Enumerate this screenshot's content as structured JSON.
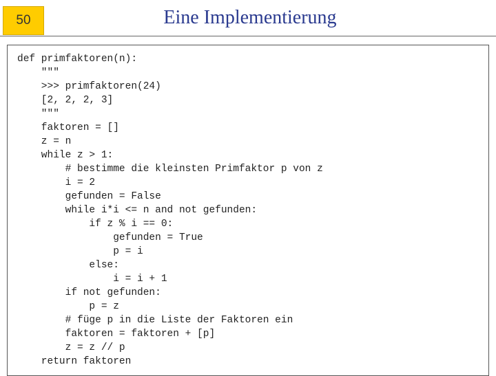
{
  "header": {
    "slide_number": "50",
    "title": "Eine Implementierung"
  },
  "code": {
    "lines": [
      "def primfaktoren(n):",
      "    \"\"\"",
      "    >>> primfaktoren(24)",
      "    [2, 2, 2, 3]",
      "    \"\"\"",
      "    faktoren = []",
      "    z = n",
      "    while z > 1:",
      "        # bestimme die kleinsten Primfaktor p von z",
      "        i = 2",
      "        gefunden = False",
      "        while i*i <= n and not gefunden:",
      "            if z % i == 0:",
      "                gefunden = True",
      "                p = i",
      "            else:",
      "                i = i + 1",
      "        if not gefunden:",
      "            p = z",
      "        # füge p in die Liste der Faktoren ein",
      "        faktoren = faktoren + [p]",
      "        z = z // p",
      "    return faktoren"
    ]
  }
}
